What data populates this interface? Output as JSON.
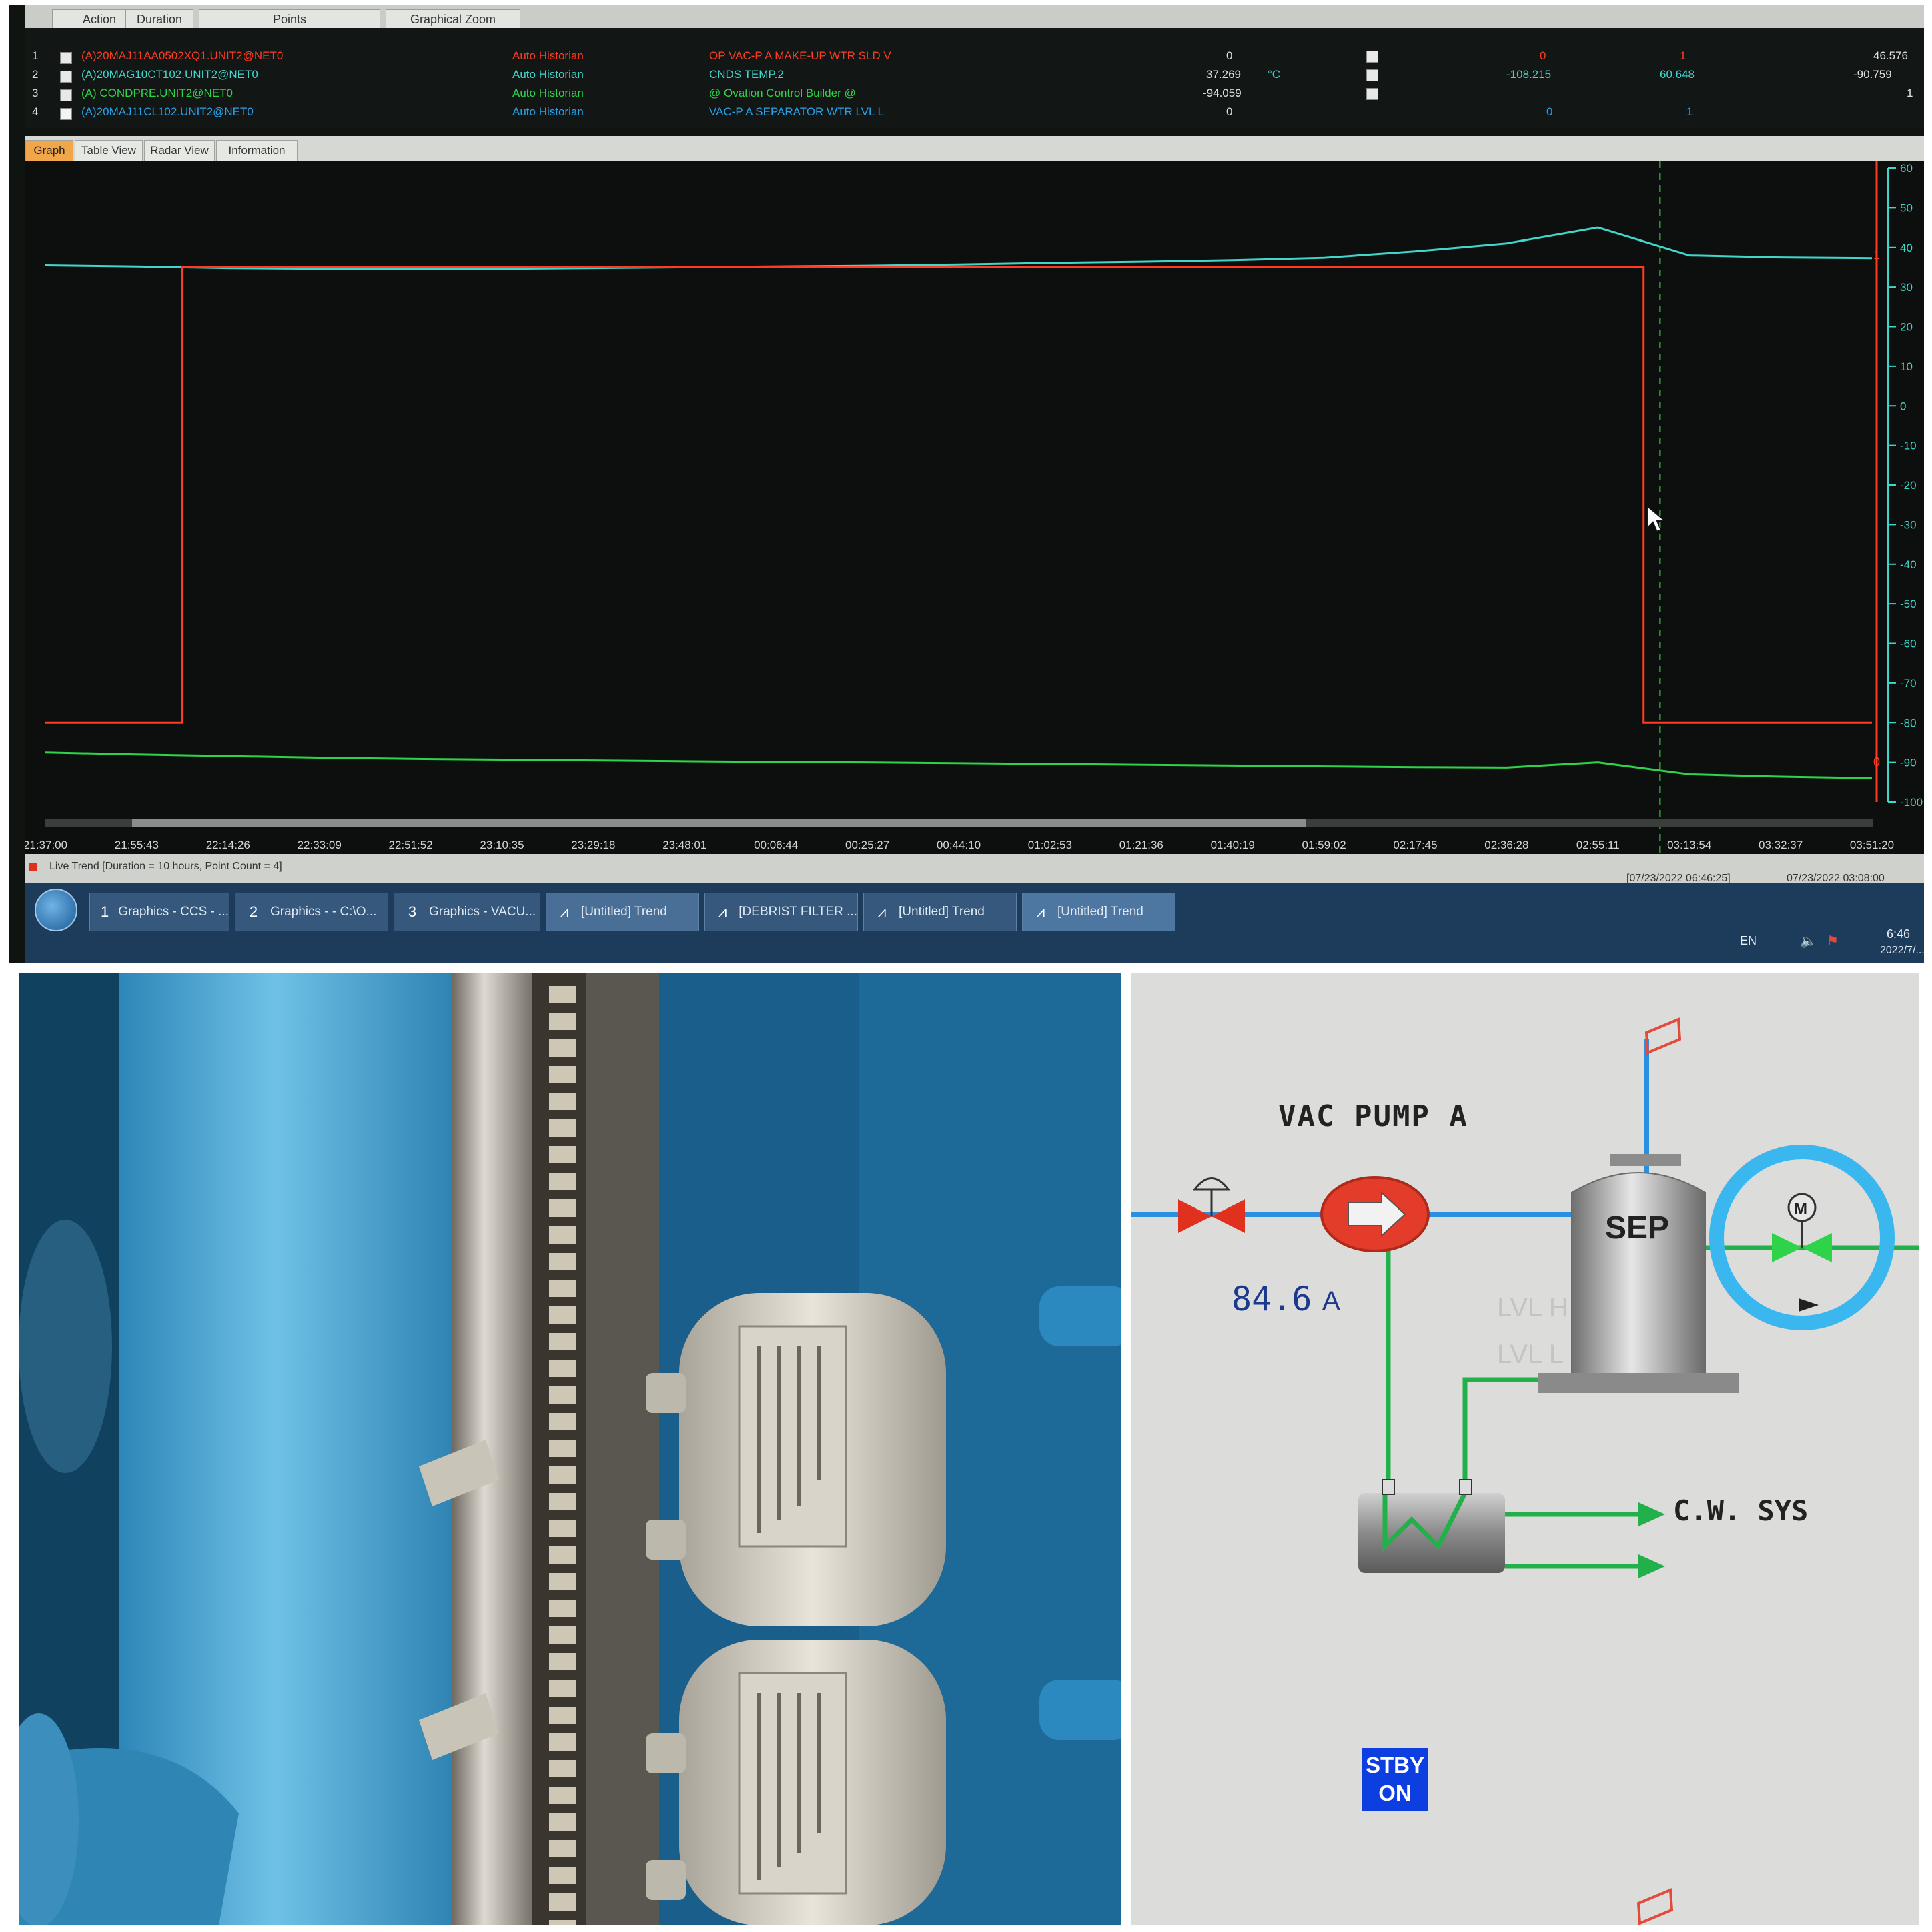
{
  "colors": {
    "red_trace": "#ff3b24",
    "teal_trace": "#3fd6cc",
    "green_trace": "#2fd34a",
    "cursor": "#3fd84d",
    "pipe_blue": "#2a8fe0",
    "pipe_green": "#22b04a",
    "highlight_circle": "#3ab7ee",
    "stby_bg": "#0d3fe0"
  },
  "trend": {
    "header_tabs": [
      "Action",
      "Duration",
      "Points",
      "Graphical Zoom"
    ],
    "points": [
      {
        "num": "1",
        "tag": "(A)20MAJ11AA0502XQ1.UNIT2@NET0",
        "source": "Auto Historian",
        "desc": "OP VAC-P A MAKE-UP WTR SLD V",
        "value": "0",
        "unit": "",
        "min": "0",
        "max": "1",
        "last": "46.576",
        "color": "#ff3b24"
      },
      {
        "num": "2",
        "tag": "(A)20MAG10CT102.UNIT2@NET0",
        "source": "Auto Historian",
        "desc": "CNDS TEMP.2",
        "value": "37.269",
        "unit": "°C",
        "min": "-108.215",
        "max": "60.648",
        "last": "-90.759",
        "color": "#3fd6cc"
      },
      {
        "num": "3",
        "tag": "(A) CONDPRE.UNIT2@NET0",
        "source": "Auto Historian",
        "desc": "@ Ovation Control Builder @",
        "value": "-94.059",
        "unit": "",
        "min": "-108.215",
        "max": "60.648",
        "last": "1",
        "color": "#2fd34a"
      },
      {
        "num": "4",
        "tag": "(A)20MAJ11CL102.UNIT2@NET0",
        "source": "Auto Historian",
        "desc": "VAC-P A SEPARATOR WTR LVL L",
        "value": "0",
        "unit": "",
        "min": "0",
        "max": "1",
        "last": "",
        "color": "#2aa0e6"
      }
    ],
    "view_tabs": [
      "Graph",
      "Table View",
      "Radar View",
      "Information"
    ],
    "active_view": "Graph",
    "status_text": "Live Trend [Duration = 10 hours, Point Count = 4]",
    "cursor_time": "[07/23/2022 06:46:25]",
    "end_time": "07/23/2022 03:08:00",
    "taskbar_items": [
      {
        "index": "1",
        "label": "Graphics - CCS - ..."
      },
      {
        "index": "2",
        "label": "Graphics - - C:\\O..."
      },
      {
        "index": "3",
        "label": "Graphics - VACU..."
      },
      {
        "index": "",
        "label": "[Untitled] Trend"
      },
      {
        "index": "",
        "label": "[DEBRIST FILTER ..."
      },
      {
        "index": "",
        "label": "[Untitled] Trend"
      },
      {
        "index": "",
        "label": "[Untitled] Trend"
      }
    ],
    "tray": {
      "lang": "EN",
      "time": "6:46",
      "date": "2022/7/..."
    },
    "digital_labels": {
      "high": "1",
      "low": "0"
    }
  },
  "chart_data": {
    "type": "line",
    "x": [
      "21:37:00",
      "21:55:43",
      "22:14:26",
      "22:33:09",
      "22:51:52",
      "23:10:35",
      "23:29:18",
      "23:48:01",
      "00:06:44",
      "00:25:27",
      "00:44:10",
      "01:02:53",
      "01:21:36",
      "01:40:19",
      "01:59:02",
      "02:17:45",
      "02:36:28",
      "02:55:11",
      "03:13:54",
      "03:32:37",
      "03:51:20"
    ],
    "y_ticks": [
      60,
      50,
      40,
      30,
      20,
      10,
      0,
      -10,
      -20,
      -30,
      -40,
      -50,
      -60,
      -70,
      -80,
      -90,
      -100
    ],
    "ylim": [
      -100,
      60
    ],
    "series": [
      {
        "name": "CNDS TEMP.2",
        "color": "#3fd6cc",
        "values": [
          35.5,
          35.2,
          34.8,
          34.6,
          34.6,
          34.6,
          34.8,
          35.0,
          35.2,
          35.4,
          35.7,
          36.1,
          36.4,
          36.8,
          37.4,
          39.0,
          41.0,
          45.0,
          38.0,
          37.5,
          37.3
        ]
      },
      {
        "name": "@ Ovation Control Builder @",
        "color": "#2fd34a",
        "values": [
          -87.5,
          -88.0,
          -88.4,
          -88.8,
          -89.1,
          -89.3,
          -89.5,
          -89.7,
          -89.9,
          -90.0,
          -90.2,
          -90.4,
          -90.6,
          -90.8,
          -91.0,
          -91.2,
          -91.3,
          -90.0,
          -93.0,
          -93.6,
          -94.0
        ]
      },
      {
        "name": "OP VAC-P A MAKE-UP WTR SLD V",
        "digital": true,
        "color": "#ff3b24",
        "values": [
          0,
          0,
          1,
          1,
          1,
          1,
          1,
          1,
          1,
          1,
          1,
          1,
          1,
          1,
          1,
          1,
          1,
          1,
          0,
          0,
          0
        ]
      }
    ],
    "cursor_at": "03:08:00",
    "grid": false
  },
  "hmi": {
    "title": "VAC PUMP A",
    "current_value": "84.6",
    "current_unit": "A",
    "separator_label": "SEP",
    "lvl_h": "LVL H",
    "lvl_l": "LVL L",
    "cw_label": "C.W. SYS",
    "motor_label": "M",
    "stby_line1": "STBY",
    "stby_line2": "ON"
  }
}
